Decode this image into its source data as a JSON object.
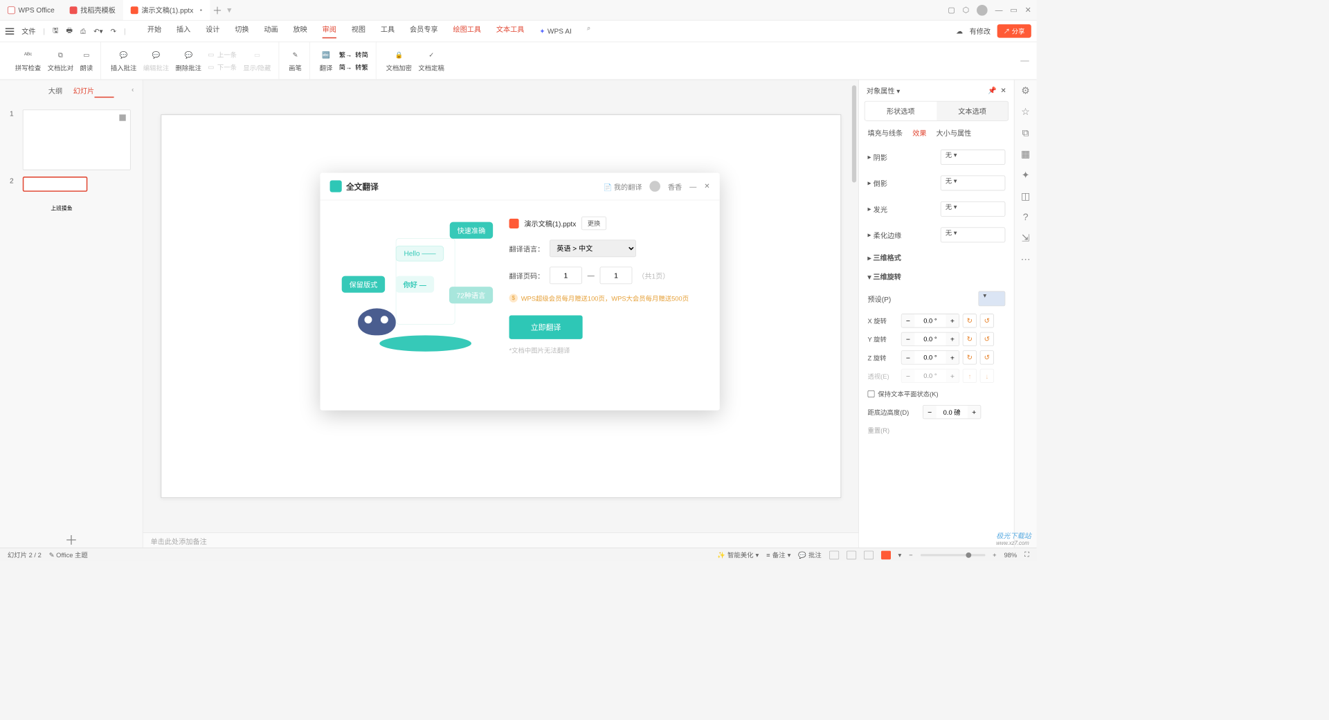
{
  "titlebar": {
    "tabs": [
      {
        "label": "WPS Office",
        "color": "#d9534f"
      },
      {
        "label": "找稻壳模板",
        "color": "#ef5350"
      },
      {
        "label": "演示文稿(1).pptx",
        "color": "#ff5a36",
        "active": true
      }
    ],
    "win": [
      "▢",
      "◇",
      "—",
      "▭",
      "✕"
    ]
  },
  "menubar": {
    "file": "文件",
    "tabs": [
      "开始",
      "插入",
      "设计",
      "切换",
      "动画",
      "放映",
      "审阅",
      "视图",
      "工具",
      "会员专享",
      "绘图工具",
      "文本工具"
    ],
    "active": "审阅",
    "highlight": [
      "绘图工具",
      "文本工具"
    ],
    "ai": "WPS AI",
    "right": {
      "changes": "有修改",
      "share": "分享"
    }
  },
  "ribbon": {
    "g1": [
      {
        "l": "拼写检查",
        "sub": "▾"
      },
      {
        "l": "文档比对"
      },
      {
        "l": "朗读"
      }
    ],
    "g2": [
      {
        "l": "插入批注"
      },
      {
        "l": "编辑批注",
        "dis": true
      },
      {
        "l": "删除批注",
        "sub": "▾"
      }
    ],
    "g2b": [
      {
        "l": "上一条",
        "dis": true
      },
      {
        "l": "下一条",
        "dis": true
      }
    ],
    "g2c": {
      "l": "显示/隐藏",
      "dis": true
    },
    "g3": [
      {
        "l": "画笔"
      }
    ],
    "g4": [
      {
        "l": "翻译"
      }
    ],
    "g4b": [
      {
        "l": "转简"
      },
      {
        "l": "转繁"
      }
    ],
    "g5": [
      {
        "l": "文档加密"
      },
      {
        "l": "文档定稿",
        "sub": "▾"
      }
    ]
  },
  "sidepanel": {
    "tabs": [
      "大纲",
      "幻灯片"
    ],
    "active": "幻灯片",
    "thumbs": [
      {
        "n": "1"
      },
      {
        "n": "2",
        "text": "上班摸鱼",
        "sel": true
      }
    ]
  },
  "canvas": {
    "notes_placeholder": "单击此处添加备注"
  },
  "dialog": {
    "title": "全文翻译",
    "my": "我的翻译",
    "user": "香香",
    "ill": {
      "b1": "快速准确",
      "b2": "Hello ——",
      "b3": "保留版式",
      "b4": "你好 —",
      "b5": "72种语言"
    },
    "file": "演示文稿(1).pptx",
    "swap": "更换",
    "lang_label": "翻译语言：",
    "lang_value": "英语 > 中文",
    "page_label": "翻译页码：",
    "page_from": "1",
    "page_to": "1",
    "page_total": "（共1页）",
    "note": "WPS超级会员每月赠送100页，WPS大会员每月赠送500页",
    "btn": "立即翻译",
    "warn": "*文档中图片无法翻译"
  },
  "props": {
    "title": "对象属性",
    "tabs": [
      "形状选项",
      "文本选项"
    ],
    "active": "形状选项",
    "subtabs": [
      "填充与线条",
      "效果",
      "大小与属性"
    ],
    "sub_active": "效果",
    "rows": [
      {
        "l": "阴影",
        "v": "无"
      },
      {
        "l": "倒影",
        "v": "无"
      },
      {
        "l": "发光",
        "v": "无"
      },
      {
        "l": "柔化边缘",
        "v": "无"
      }
    ],
    "sec1": "三维格式",
    "sec2": "三维旋转",
    "preset": "预设(P)",
    "rot": [
      {
        "l": "X 旋转",
        "v": "0.0 °"
      },
      {
        "l": "Y 旋转",
        "v": "0.0 °"
      },
      {
        "l": "Z 旋转",
        "v": "0.0 °"
      },
      {
        "l": "透视(E)",
        "v": "0.0 °",
        "dis": true
      }
    ],
    "keep_flat": "保持文本平面状态(K)",
    "dist_label": "距底边高度(D)",
    "dist_val": "0.0 磅",
    "reset": "重置(R)"
  },
  "status": {
    "slide": "幻灯片 2 / 2",
    "theme": "Office 主题",
    "beauty": "智能美化",
    "notes": "备注",
    "comments": "批注",
    "zoom": "98%"
  },
  "watermark": {
    "t": "极光下载站",
    "s": "www.xz7.com"
  }
}
